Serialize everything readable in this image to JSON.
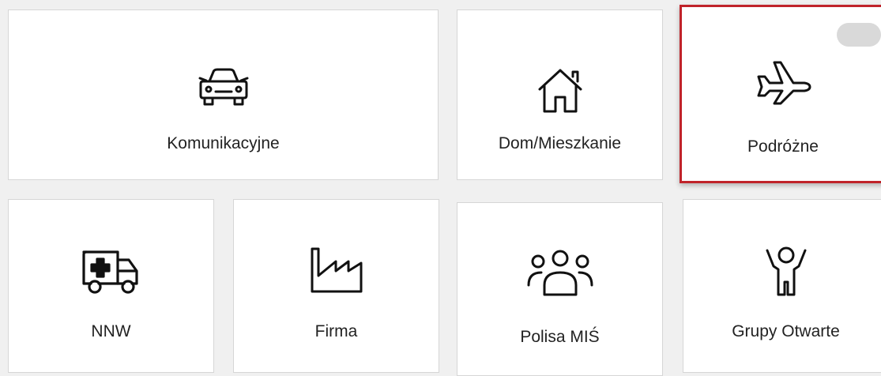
{
  "tiles": [
    {
      "id": "komunikacyjne",
      "label": "Komunikacyjne",
      "icon": "car-icon",
      "selected": false
    },
    {
      "id": "dom",
      "label": "Dom/Mieszkanie",
      "icon": "house-icon",
      "selected": false
    },
    {
      "id": "podrozne",
      "label": "Podróżne",
      "icon": "airplane-icon",
      "selected": true
    },
    {
      "id": "nnw",
      "label": "NNW",
      "icon": "ambulance-icon",
      "selected": false
    },
    {
      "id": "firma",
      "label": "Firma",
      "icon": "factory-icon",
      "selected": false
    },
    {
      "id": "polisa",
      "label": "Polisa MIŚ",
      "icon": "group-icon",
      "selected": false
    },
    {
      "id": "grupy",
      "label": "Grupy Otwarte",
      "icon": "child-icon",
      "selected": false
    }
  ],
  "colors": {
    "background": "#f0f0f0",
    "tile": "#ffffff",
    "selected_border": "#c0232a",
    "text": "#222222"
  }
}
